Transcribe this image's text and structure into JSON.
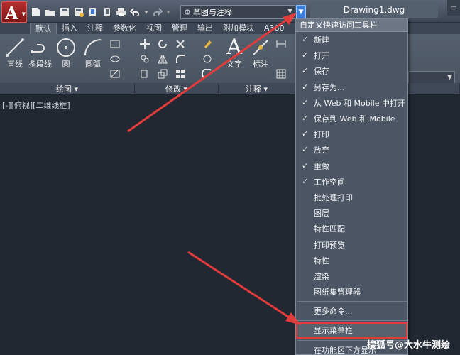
{
  "window": {
    "app_logo": "A",
    "doc_title": "Drawing1.dwg",
    "workspace": "草图与注释"
  },
  "tabs": [
    "默认",
    "插入",
    "注释",
    "参数化",
    "视图",
    "管理",
    "输出",
    "附加模块",
    "A360"
  ],
  "ribbon": {
    "draw_tools": [
      {
        "label": "直线"
      },
      {
        "label": "多段线"
      },
      {
        "label": "圆"
      },
      {
        "label": "圆弧"
      }
    ],
    "annot_tools": [
      {
        "label": "文字"
      },
      {
        "label": "标注"
      }
    ],
    "panels": [
      {
        "label": "绘图 ▾"
      },
      {
        "label": "修改 ▾"
      },
      {
        "label": "注释 ▾"
      }
    ]
  },
  "viewport": {
    "label": "[-][俯视][二维线框]"
  },
  "menu": {
    "title": "自定义快速访问工具栏",
    "checked_items": [
      {
        "label": "新建"
      },
      {
        "label": "打开"
      },
      {
        "label": "保存"
      },
      {
        "label": "另存为..."
      },
      {
        "label": "从 Web 和 Mobile 中打开"
      },
      {
        "label": "保存到 Web 和 Mobile"
      },
      {
        "label": "打印"
      },
      {
        "label": "放弃"
      },
      {
        "label": "重做"
      },
      {
        "label": "工作空间"
      }
    ],
    "unchecked_items": [
      {
        "label": "批处理打印"
      },
      {
        "label": "图层"
      },
      {
        "label": "特性匹配"
      },
      {
        "label": "打印预览"
      },
      {
        "label": "特性"
      },
      {
        "label": "渲染"
      },
      {
        "label": "图纸集管理器"
      }
    ],
    "more_commands": "更多命令...",
    "show_menubar": "显示菜单栏",
    "below_ribbon": "在功能区下方显示"
  },
  "watermark": "搜狐号@大水牛测绘",
  "colors": {
    "arrow": "#e23b3b",
    "highlight_border": "#e23b3b",
    "qat_customize": "#3b7dd8"
  }
}
